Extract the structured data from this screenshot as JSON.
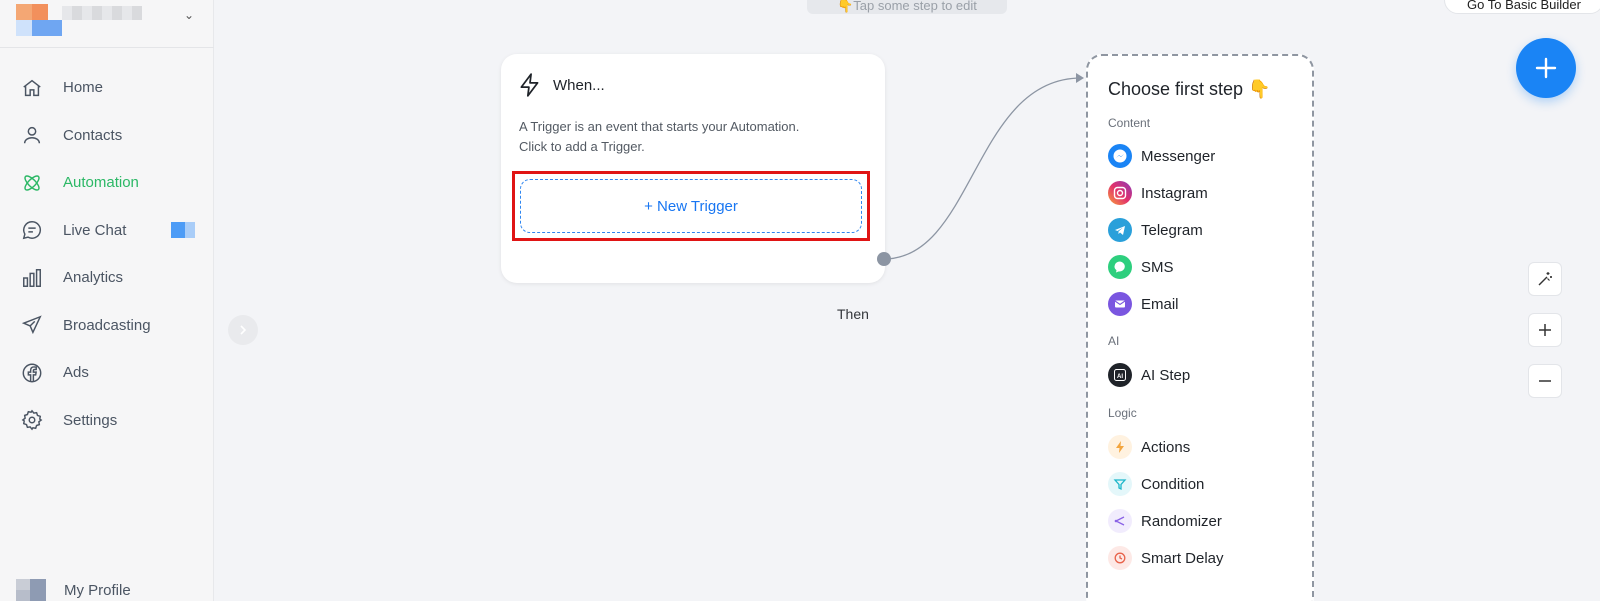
{
  "sidebar": {
    "items": [
      {
        "label": "Home",
        "icon": "home-icon"
      },
      {
        "label": "Contacts",
        "icon": "contacts-icon"
      },
      {
        "label": "Automation",
        "icon": "automation-icon",
        "active": true
      },
      {
        "label": "Live Chat",
        "icon": "live-chat-icon"
      },
      {
        "label": "Analytics",
        "icon": "analytics-icon"
      },
      {
        "label": "Broadcasting",
        "icon": "broadcasting-icon"
      },
      {
        "label": "Ads",
        "icon": "ads-icon"
      },
      {
        "label": "Settings",
        "icon": "settings-icon"
      }
    ],
    "profile_label": "My Profile"
  },
  "canvas": {
    "hint": "👇Tap some step to edit",
    "basic_builder": "Go To Basic Builder"
  },
  "trigger_card": {
    "title": "When...",
    "desc_line1": "A Trigger is an event that starts your Automation.",
    "desc_line2": "Click to add a Trigger.",
    "new_trigger": "+ New Trigger",
    "then": "Then"
  },
  "first_step": {
    "heading": "Choose first step 👇",
    "sections": {
      "content": "Content",
      "ai": "AI",
      "logic": "Logic"
    },
    "items": {
      "messenger": "Messenger",
      "instagram": "Instagram",
      "telegram": "Telegram",
      "sms": "SMS",
      "email": "Email",
      "ai_step": "AI Step",
      "actions": "Actions",
      "condition": "Condition",
      "randomizer": "Randomizer",
      "smart_delay": "Smart Delay"
    }
  },
  "colors": {
    "accent": "#1a84f5",
    "active_nav": "#2cb866",
    "highlight": "#e01414"
  }
}
